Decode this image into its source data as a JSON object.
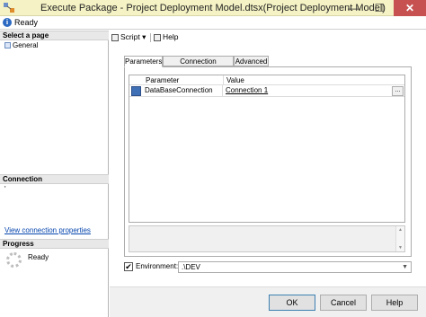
{
  "window": {
    "title": "Execute Package - Project Deployment Model.dtsx(Project Deployment Model)",
    "min_glyph": "—",
    "max_glyph": "☐",
    "close_glyph": "✕"
  },
  "status": {
    "icon_glyph": "i",
    "text": "Ready"
  },
  "left_pane": {
    "select_page_header": "Select a page",
    "pages": [
      {
        "label": "General"
      }
    ],
    "connection_header": "Connection",
    "connection_value": "'",
    "view_connection_link": "View connection properties",
    "progress_header": "Progress",
    "progress_text": "Ready"
  },
  "toolbar": {
    "script_label": "Script",
    "script_dropdown_glyph": "▾",
    "help_label": "Help"
  },
  "tabs": [
    {
      "label": "Parameters",
      "active": true
    },
    {
      "label": "Connection Managers",
      "active": false
    },
    {
      "label": "Advanced",
      "active": false
    }
  ],
  "grid": {
    "columns": [
      "Parameter",
      "Value"
    ],
    "rows": [
      {
        "parameter": "DataBaseConnection",
        "value": "Connection 1",
        "button": "..."
      }
    ]
  },
  "description_box": {
    "up_arrow": "▲",
    "down_arrow": "▼"
  },
  "environment": {
    "checked": true,
    "check_glyph": "✔",
    "label": "Environment:",
    "value": ".\\DEV",
    "dropdown_glyph": "▼"
  },
  "buttons": {
    "ok": "OK",
    "cancel": "Cancel",
    "help": "Help"
  }
}
